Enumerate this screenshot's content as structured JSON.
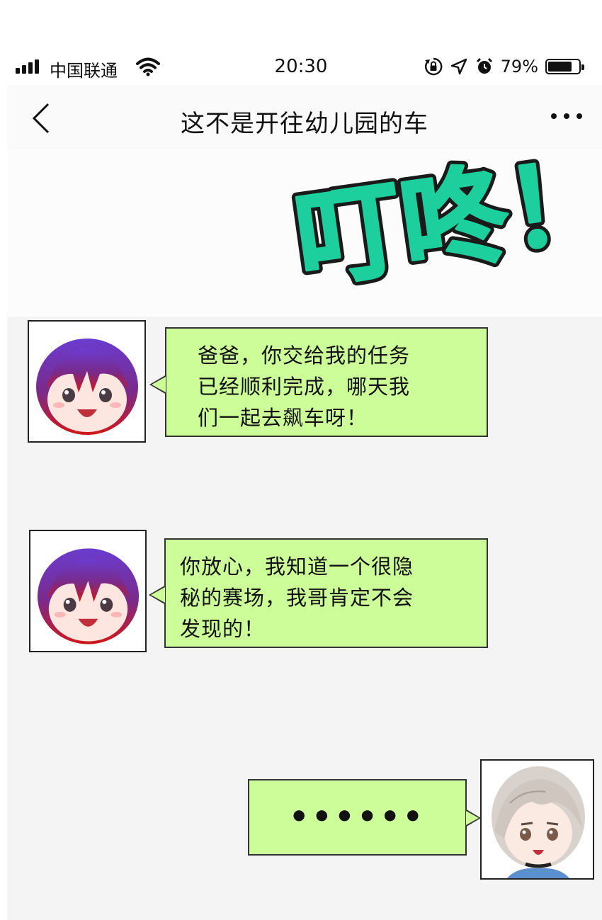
{
  "status_bar": {
    "carrier": "中国联通",
    "time": "20:30",
    "battery_percent": "79%",
    "battery_level": 0.79,
    "icons": [
      "signal-icon",
      "wifi-icon",
      "orientation-lock-icon",
      "location-arrow-icon",
      "alarm-icon",
      "battery-icon"
    ]
  },
  "nav": {
    "back_icon": "chevron-left-icon",
    "title": "这不是开往幼儿园的车",
    "more_icon": "more-dots-icon"
  },
  "sound_effect": {
    "text": "叮咚！",
    "color": "#1ccf9c",
    "outline": "#1a1a1a"
  },
  "messages": [
    {
      "side": "left",
      "avatar": "avatar-purple-red-hair-boy",
      "text": "爸爸，你交给我的任务\n已经顺利完成，哪天我\n们一起去飙车呀！"
    },
    {
      "side": "left",
      "avatar": "avatar-purple-red-hair-boy",
      "text": "你放心，我知道一个很隐\n秘的赛场，我哥肯定不会\n发现的！"
    },
    {
      "side": "right",
      "avatar": "avatar-silver-hair-man",
      "text": "••••••"
    }
  ],
  "colors": {
    "bubble_bg": "#ccfd99",
    "chat_bg": "#f4f4f4",
    "nav_bg": "#fafafa"
  }
}
